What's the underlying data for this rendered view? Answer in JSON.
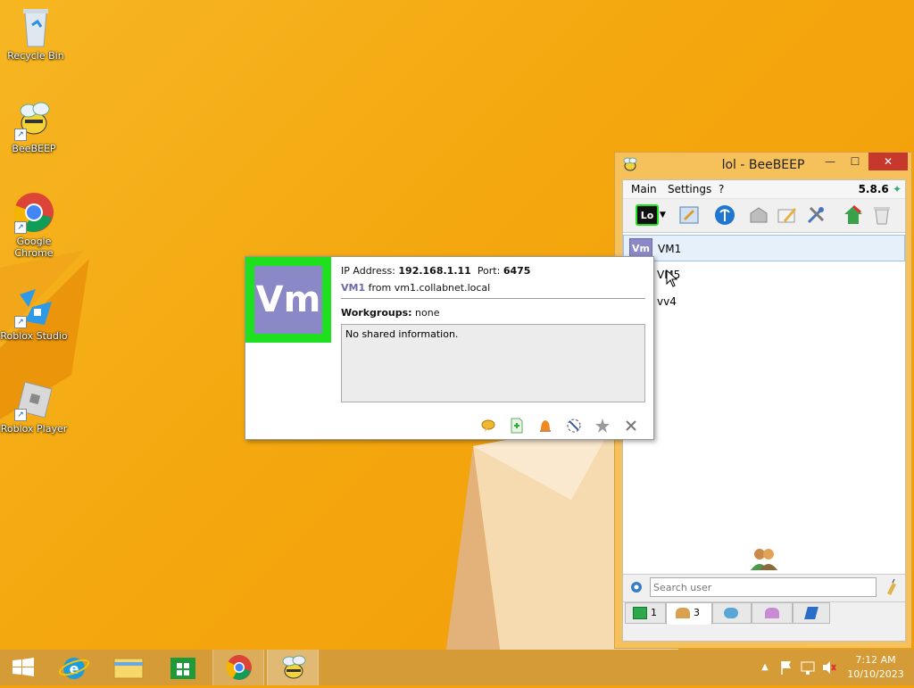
{
  "desktop": {
    "icons": [
      {
        "label": "Recycle Bin",
        "icon": "recycle-bin-icon"
      },
      {
        "label": "BeeBEEP",
        "icon": "bee-icon"
      },
      {
        "label": "Google Chrome",
        "icon": "chrome-icon"
      },
      {
        "label": "Roblox Studio",
        "icon": "roblox-studio-icon"
      },
      {
        "label": "Roblox Player",
        "icon": "roblox-player-icon"
      }
    ]
  },
  "window": {
    "title": "lol - BeeBEEP",
    "minimize": "—",
    "maximize": "☐",
    "close": "✕",
    "menu": {
      "main": "Main",
      "settings": "Settings",
      "help": "?"
    },
    "version": "5.8.6",
    "status_label": "Lo",
    "users": [
      {
        "badge": "Vm",
        "name": "VM1"
      },
      {
        "name": "VM5"
      },
      {
        "name": "vv4"
      }
    ],
    "search_placeholder": "Search user",
    "tabs": [
      {
        "label": "1",
        "icon": "chat-icon"
      },
      {
        "label": "3",
        "icon": "users-icon"
      },
      {
        "label": "",
        "icon": "group-chat-icon"
      },
      {
        "label": "",
        "icon": "groups-icon"
      },
      {
        "label": "",
        "icon": "share-icon"
      }
    ]
  },
  "card": {
    "avatar": "Vm",
    "ip_label": "IP Address:",
    "ip": "192.168.1.11",
    "port_label": "Port:",
    "port": "6475",
    "user": "VM1",
    "from_text": "from vm1.collabnet.local",
    "workgroups_label": "Workgroups:",
    "workgroups_value": "none",
    "shared_info": "No shared information."
  },
  "taskbar": {
    "time": "7:12 AM",
    "date": "10/10/2023"
  },
  "colors": {
    "accent_orange": "#f4a70e",
    "avatar_purple": "#8a88c6",
    "avatar_border_green": "#1ee01e",
    "close_red": "#c7382c"
  }
}
